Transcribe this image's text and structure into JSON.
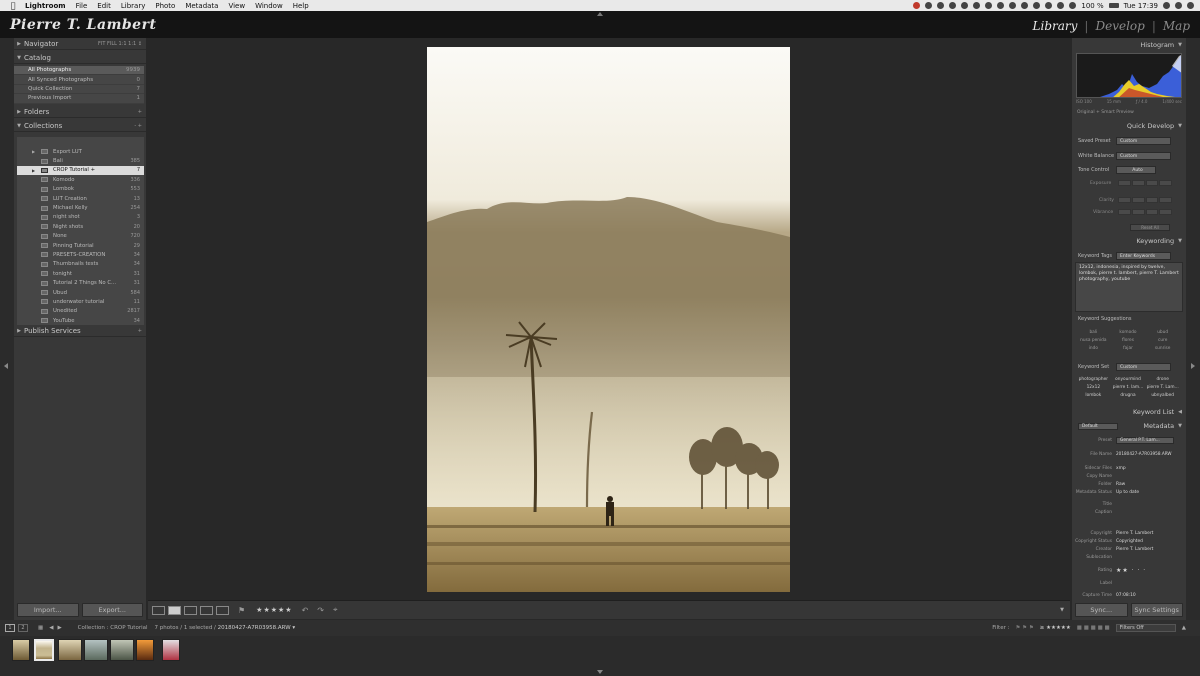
{
  "menubar": {
    "apple": "",
    "items": [
      "Lightroom",
      "File",
      "Edit",
      "Library",
      "Photo",
      "Metadata",
      "View",
      "Window",
      "Help"
    ],
    "battery": "100 %",
    "clock": "Tue 17:39"
  },
  "identity_plate": "Pierre T. Lambert",
  "modules": [
    "Library",
    "Develop",
    "Map"
  ],
  "active_module": "Library",
  "left_panel": {
    "navigator": {
      "title": "Navigator",
      "zoom_options": "FIT  FILL  1:1  1:1 ↕"
    },
    "catalog": {
      "title": "Catalog",
      "items": [
        {
          "label": "All Photographs",
          "count": "9939"
        },
        {
          "label": "All Synced Photographs",
          "count": "0"
        },
        {
          "label": "Quick Collection",
          "count": "7"
        },
        {
          "label": "Previous Import",
          "count": "1"
        }
      ]
    },
    "folders": {
      "title": "Folders",
      "add": "+"
    },
    "collections": {
      "title": "Collections",
      "add": "-  +",
      "items": [
        {
          "label": "Export LUT",
          "count": "",
          "expand": "▶"
        },
        {
          "label": "Bali",
          "count": "385",
          "expand": ""
        },
        {
          "label": "CROP Tutorial  +",
          "count": "7",
          "expand": "▶"
        },
        {
          "label": "Komodo",
          "count": "336",
          "expand": ""
        },
        {
          "label": "Lombok",
          "count": "553",
          "expand": ""
        },
        {
          "label": "LUT Creation",
          "count": "13",
          "expand": ""
        },
        {
          "label": "Michael Kelly",
          "count": "254",
          "expand": ""
        },
        {
          "label": "night shot",
          "count": "3",
          "expand": ""
        },
        {
          "label": "Night shots",
          "count": "20",
          "expand": ""
        },
        {
          "label": "None",
          "count": "720",
          "expand": ""
        },
        {
          "label": "Pinning Tutorial",
          "count": "29",
          "expand": ""
        },
        {
          "label": "PRESETS-CREATION",
          "count": "34",
          "expand": ""
        },
        {
          "label": "Thumbnails tests",
          "count": "34",
          "expand": ""
        },
        {
          "label": "tonight",
          "count": "31",
          "expand": ""
        },
        {
          "label": "Tutorial 2 Things No C...",
          "count": "31",
          "expand": ""
        },
        {
          "label": "Ubud",
          "count": "584",
          "expand": ""
        },
        {
          "label": "underwater tutorial",
          "count": "11",
          "expand": ""
        },
        {
          "label": "Unedited",
          "count": "2817",
          "expand": ""
        },
        {
          "label": "YouTube",
          "count": "34",
          "expand": ""
        }
      ]
    },
    "publish": {
      "title": "Publish Services",
      "add": "+"
    },
    "import_button": "Import...",
    "export_button": "Export..."
  },
  "toolbar": {
    "rating_stars": "★★★★★",
    "rating_value": 2
  },
  "right_panel": {
    "histogram": {
      "title": "Histogram",
      "iso": "ISO 100",
      "focal": "15 mm",
      "aperture": "ƒ / 4.0",
      "shutter": "1/400 sec",
      "smart_preview": "Original + Smart Preview"
    },
    "quick_develop": {
      "title": "Quick Develop",
      "saved_preset_label": "Saved Preset",
      "saved_preset_value": "Custom",
      "white_balance_label": "White Balance",
      "white_balance_value": "Custom",
      "tone_control_label": "Tone Control",
      "auto_label": "Auto",
      "exposure_label": "Exposure",
      "clarity_label": "Clarity",
      "vibrance_label": "Vibrance",
      "reset_label": "Reset All"
    },
    "keywording": {
      "title": "Keywording",
      "tags_label": "Keyword Tags",
      "tags_value": "Enter Keywords",
      "keywords_text": "12x12, indonesia, inspired by twelve, lombok, pierre t. lambert, pierre T. Lambert photography, youtube",
      "suggestions_label": "Keyword Suggestions",
      "suggestions": [
        "bali",
        "komodo",
        "ubud",
        "nusa penida",
        "flores",
        "cure",
        "indo",
        "fajar",
        "sunrise"
      ],
      "set_label": "Keyword Set",
      "set_value": "Custom",
      "set_items": [
        "photographer",
        "onyourmind",
        "drone",
        "12x12",
        "pierre t. lam...",
        "pierre T. Lam...",
        "lombok",
        "drugna",
        "ubnyalbed"
      ]
    },
    "keyword_list": {
      "title": "Keyword List"
    },
    "metadata": {
      "title": "Metadata",
      "default_value": "Default",
      "preset_label": "Preset",
      "preset_value": "General P.T. Lam...",
      "fields": [
        {
          "key": "File Name",
          "value": "20180427-A7R03958.ARW"
        },
        {
          "key": "Sidecar Files",
          "value": "xmp"
        },
        {
          "key": "Copy Name",
          "value": ""
        },
        {
          "key": "Folder",
          "value": "Raw"
        },
        {
          "key": "Metadata Status",
          "value": "Up to date"
        },
        {
          "key": "Title",
          "value": ""
        },
        {
          "key": "Caption",
          "value": ""
        },
        {
          "key": "Copyright",
          "value": "Pierre T. Lambert"
        },
        {
          "key": "Copyright Status",
          "value": "Copyrighted"
        },
        {
          "key": "Creator",
          "value": "Pierre T. Lambert"
        },
        {
          "key": "Sublocation",
          "value": ""
        },
        {
          "key": "Rating",
          "value": "★★ · · ·"
        },
        {
          "key": "Label",
          "value": ""
        },
        {
          "key": "Capture Time",
          "value": "07:08:10"
        }
      ]
    },
    "sync_button": "Sync...",
    "sync_settings_button": "Sync Settings"
  },
  "filmstrip_bar": {
    "page1": "1",
    "page2": "2",
    "source": "Collection : CROP Tutorial",
    "count": "7 photos / 1 selected /",
    "filename": "20180427-A7R03958.ARW ▾",
    "filter_label": "Filter :",
    "filter_value": "Filters Off"
  },
  "colors": {
    "panel_bg": "#383838",
    "canvas_bg": "#282828",
    "selected_row": "#dcdcdc",
    "histogram_blue": "#3b5fd8",
    "histogram_yellow": "#e8cc2a"
  }
}
